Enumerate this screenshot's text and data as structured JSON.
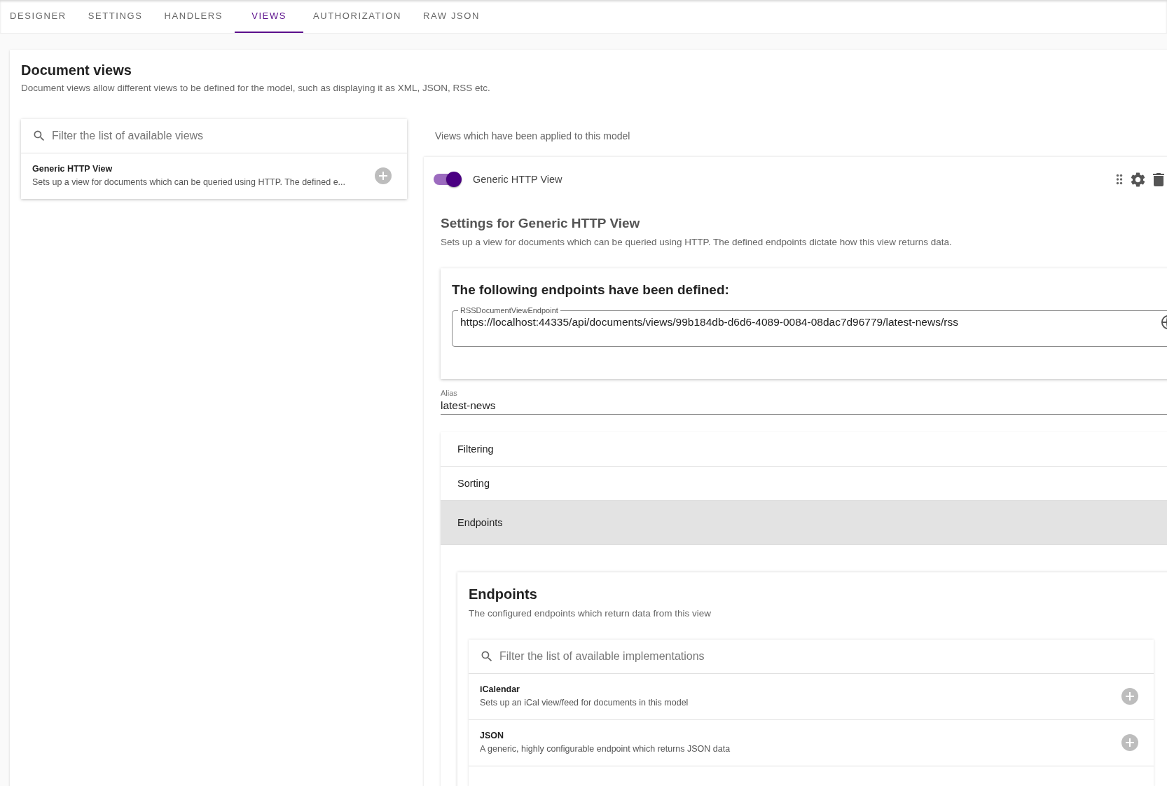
{
  "tabs": [
    {
      "label": "DESIGNER",
      "selected": false
    },
    {
      "label": "SETTINGS",
      "selected": false
    },
    {
      "label": "HANDLERS",
      "selected": false
    },
    {
      "label": "VIEWS",
      "selected": true
    },
    {
      "label": "AUTHORIZATION",
      "selected": false
    },
    {
      "label": "RAW JSON",
      "selected": false
    }
  ],
  "page": {
    "title": "Document views",
    "description": "Document views allow different views to be defined for the model, such as displaying it as XML, JSON, RSS etc."
  },
  "available": {
    "search_placeholder": "Filter the list of available views",
    "items": [
      {
        "title": "Generic HTTP View",
        "description": "Sets up a view for documents which can be queried using HTTP. The defined e..."
      }
    ]
  },
  "applied": {
    "heading": "Views which have been applied to this model",
    "views": [
      {
        "name": "Generic HTTP View",
        "enabled": true,
        "settings_title": "Settings for Generic HTTP View",
        "settings_description": "Sets up a view for documents which can be queried using HTTP. The defined endpoints dictate how this view returns data.",
        "defined": {
          "title": "The following endpoints have been defined:",
          "fields": [
            {
              "label": "RSSDocumentViewEndpoint",
              "value": "https://localhost:44335/api/documents/views/99b184db-d6d6-4089-0084-08dac7d96779/latest-news/rss"
            }
          ]
        },
        "alias": {
          "label": "Alias",
          "value": "latest-news"
        },
        "panels": [
          {
            "label": "Filtering",
            "expanded": false
          },
          {
            "label": "Sorting",
            "expanded": false
          },
          {
            "label": "Endpoints",
            "expanded": true
          }
        ],
        "endpoints": {
          "title": "Endpoints",
          "description": "The configured endpoints which return data from this view",
          "search_placeholder": "Filter the list of available implementations",
          "items": [
            {
              "title": "iCalendar",
              "description": "Sets up an iCal view/feed for documents in this model"
            },
            {
              "title": "JSON",
              "description": "A generic, highly configurable endpoint which returns JSON data"
            }
          ]
        }
      }
    ]
  }
}
